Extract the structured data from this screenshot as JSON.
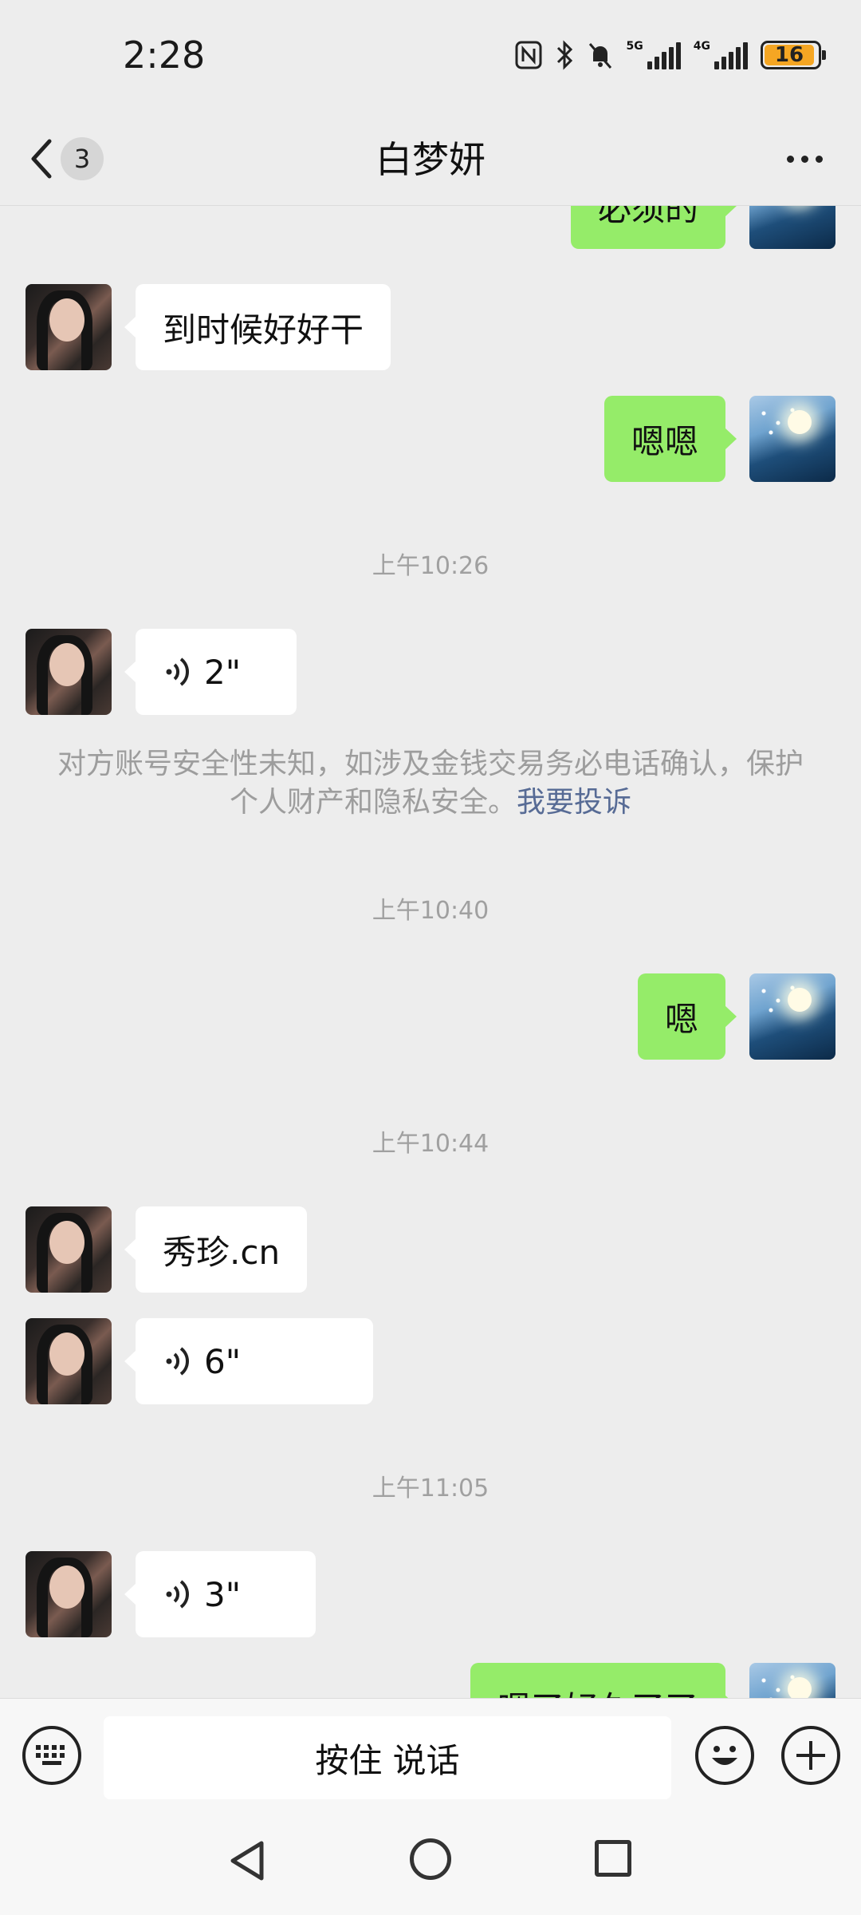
{
  "status_bar": {
    "time": "2:28",
    "net1": "5G",
    "net2": "4G",
    "battery": "16",
    "icons": [
      "nfc-icon",
      "bluetooth-icon",
      "mute-icon",
      "signal-5g-icon",
      "signal-4g-icon",
      "battery-icon"
    ]
  },
  "header": {
    "unread_count": "3",
    "title": "白梦妍"
  },
  "messages": [
    {
      "type": "text",
      "from": "me",
      "text": "必须的"
    },
    {
      "type": "text",
      "from": "her",
      "text": "到时候好好干"
    },
    {
      "type": "text",
      "from": "me",
      "text": "嗯嗯"
    },
    {
      "type": "time",
      "text": "上午10:26"
    },
    {
      "type": "voice",
      "from": "her",
      "duration": "2\""
    },
    {
      "type": "notice",
      "text": "对方账号安全性未知，如涉及金钱交易务必电话确认，保护个人财产和隐私安全。",
      "link": "我要投诉"
    },
    {
      "type": "time",
      "text": "上午10:40"
    },
    {
      "type": "text",
      "from": "me",
      "text": "嗯"
    },
    {
      "type": "time",
      "text": "上午10:44"
    },
    {
      "type": "text",
      "from": "her",
      "text": "秀珍.cn"
    },
    {
      "type": "voice",
      "from": "her",
      "duration": "6\""
    },
    {
      "type": "time",
      "text": "上午11:05"
    },
    {
      "type": "voice",
      "from": "her",
      "duration": "3\""
    },
    {
      "type": "text",
      "from": "me",
      "text": "嗯了好久了了"
    }
  ],
  "input_bar": {
    "hold_to_talk": "按住 说话"
  },
  "colors": {
    "background": "#ededed",
    "outgoing_bubble": "#95ec69",
    "incoming_bubble": "#ffffff",
    "link": "#576b95",
    "battery_fill": "#f5a623"
  }
}
